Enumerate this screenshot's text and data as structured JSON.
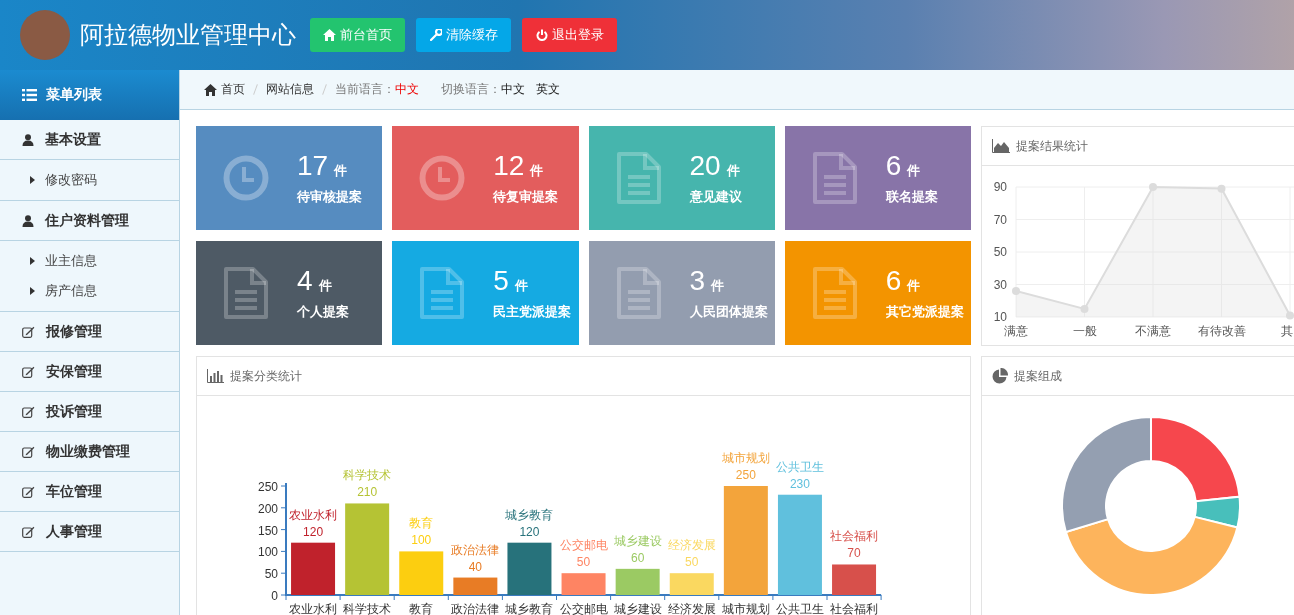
{
  "header": {
    "title": "阿拉德物业管理中心",
    "buttons": [
      {
        "label": "前台首页",
        "kind": "home"
      },
      {
        "label": "清除缓存",
        "kind": "wrench"
      },
      {
        "label": "退出登录",
        "kind": "power"
      }
    ]
  },
  "sidebar": {
    "title": "菜单列表",
    "items": [
      {
        "label": "基本设置",
        "kind": "user",
        "children": [
          {
            "label": "修改密码"
          }
        ]
      },
      {
        "label": "住户资料管理",
        "kind": "user",
        "children": [
          {
            "label": "业主信息"
          },
          {
            "label": "房产信息"
          }
        ]
      },
      {
        "label": "报修管理",
        "kind": "edit"
      },
      {
        "label": "安保管理",
        "kind": "edit"
      },
      {
        "label": "投诉管理",
        "kind": "edit"
      },
      {
        "label": "物业缴费管理",
        "kind": "edit"
      },
      {
        "label": "车位管理",
        "kind": "edit"
      },
      {
        "label": "人事管理",
        "kind": "edit"
      }
    ]
  },
  "breadcrumb": {
    "items": [
      "首页",
      "网站信息"
    ],
    "current_label": "当前语言：",
    "current_value": "中文",
    "switch_label": "切换语言：",
    "languages": [
      "中文",
      "英文"
    ]
  },
  "stats": [
    {
      "count": "17",
      "unit": "件",
      "label": "待审核提案",
      "color": "#568cc0"
    },
    {
      "count": "12",
      "unit": "件",
      "label": "待复审提案",
      "color": "#e35d5d"
    },
    {
      "count": "20",
      "unit": "件",
      "label": "意见建议",
      "color": "#46b5ad"
    },
    {
      "count": "6",
      "unit": "件",
      "label": "联名提案",
      "color": "#8874a8"
    },
    {
      "count": "4",
      "unit": "件",
      "label": "个人提案",
      "color": "#4e5a65"
    },
    {
      "count": "5",
      "unit": "件",
      "label": "民主党派提案",
      "color": "#15aae2"
    },
    {
      "count": "3",
      "unit": "件",
      "label": "人民团体提案",
      "color": "#939daf"
    },
    {
      "count": "6",
      "unit": "件",
      "label": "其它党派提案",
      "color": "#f39400"
    }
  ],
  "result_panel": {
    "title": "提案结果统计",
    "chart_data": {
      "type": "area",
      "categories": [
        "满意",
        "一般",
        "不满意",
        "有待改善",
        "其"
      ],
      "series": [
        {
          "color": "#dcdcdc",
          "values": [
            26,
            15,
            90,
            89,
            11
          ]
        }
      ],
      "ylim": [
        10,
        90
      ],
      "yticks": [
        10,
        30,
        50,
        70,
        90
      ],
      "grid": true
    }
  },
  "category_panel": {
    "title": "提案分类统计",
    "chart_data": {
      "type": "bar",
      "categories": [
        "农业水利",
        "科学技术",
        "教育",
        "政治法律",
        "城乡教育",
        "公交邮电",
        "城乡建设",
        "经济发展",
        "城市规划",
        "公共卫生",
        "社会福利"
      ],
      "series": [
        {
          "values": [
            120,
            210,
            100,
            40,
            120,
            50,
            60,
            50,
            250,
            230,
            70
          ]
        }
      ],
      "colors": [
        "#c0222c",
        "#b5c334",
        "#fcce10",
        "#e87c25",
        "#27727b",
        "#fe8463",
        "#9bca63",
        "#fad860",
        "#f3a43b",
        "#60c0dd",
        "#d7504b"
      ],
      "ylim": [
        0,
        250
      ],
      "yticks": [
        0,
        50,
        100,
        150,
        200,
        250
      ],
      "data_labels": true
    }
  },
  "composition_panel": {
    "title": "提案组成"
  }
}
